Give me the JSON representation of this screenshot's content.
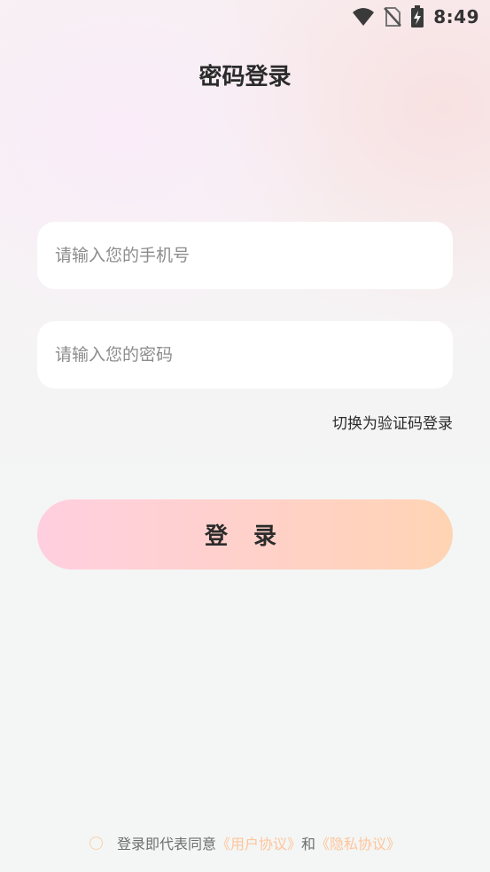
{
  "status_bar": {
    "time": "8:49",
    "icons": [
      "wifi-icon",
      "no-sim-icon",
      "battery-charging-icon"
    ]
  },
  "header": {
    "title": "密码登录"
  },
  "form": {
    "phone": {
      "placeholder": "请输入您的手机号",
      "value": ""
    },
    "password": {
      "placeholder": "请输入您的密码",
      "value": ""
    },
    "switch_label": "切换为验证码登录",
    "login_label": "登 录"
  },
  "agreement": {
    "checked": false,
    "prefix": "登录即代表同意",
    "user_agreement": "《用户协议》",
    "conjunction": "和",
    "privacy_policy": "《隐私协议》"
  },
  "colors": {
    "accent": "#ffc49b",
    "button_gradient_start": "#ffcfe0",
    "button_gradient_end": "#ffd4b4",
    "title_text": "#2b2b2b",
    "placeholder_text": "#8c8c8c"
  }
}
